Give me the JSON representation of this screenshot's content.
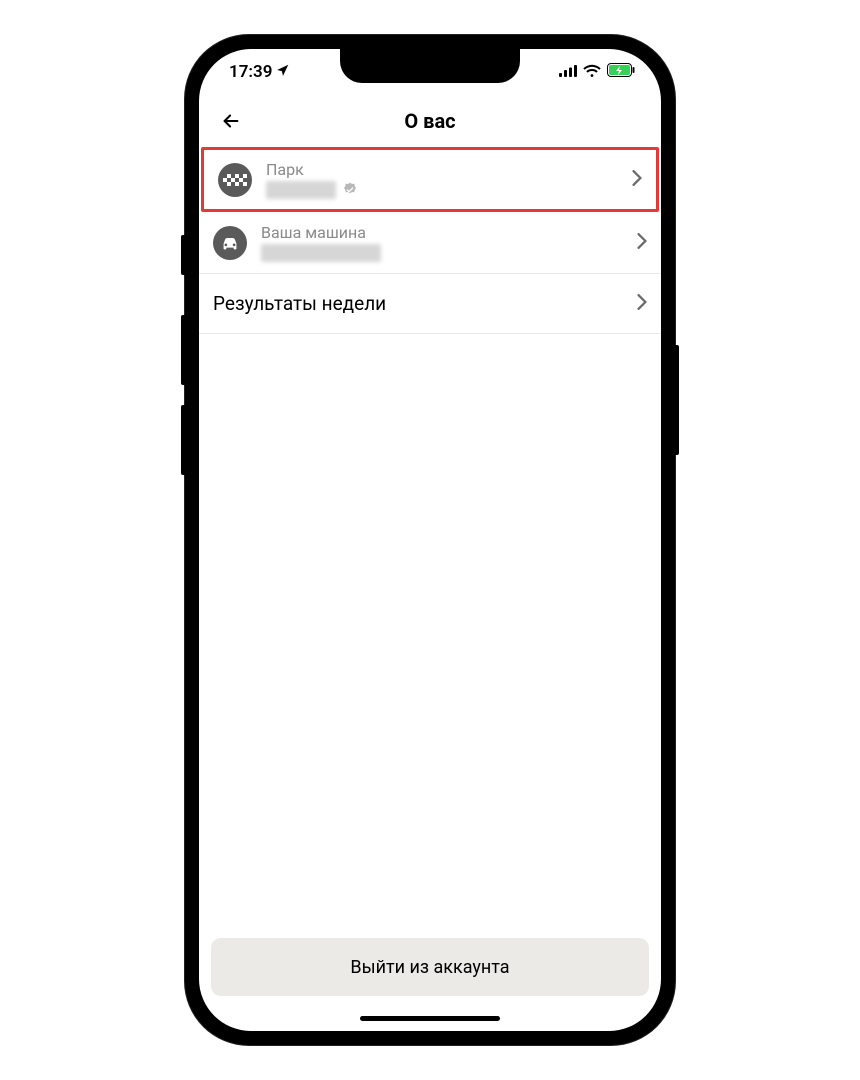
{
  "status_bar": {
    "time": "17:39"
  },
  "header": {
    "title": "О вас"
  },
  "rows": {
    "park": {
      "label": "Парк"
    },
    "vehicle": {
      "label": "Ваша машина"
    },
    "weekly": {
      "label": "Результаты недели"
    }
  },
  "actions": {
    "logout": "Выйти из аккаунта"
  },
  "colors": {
    "highlight_border": "#e13a3a",
    "icon_bg": "#5a5a5a",
    "logout_bg": "#ebeae6"
  }
}
